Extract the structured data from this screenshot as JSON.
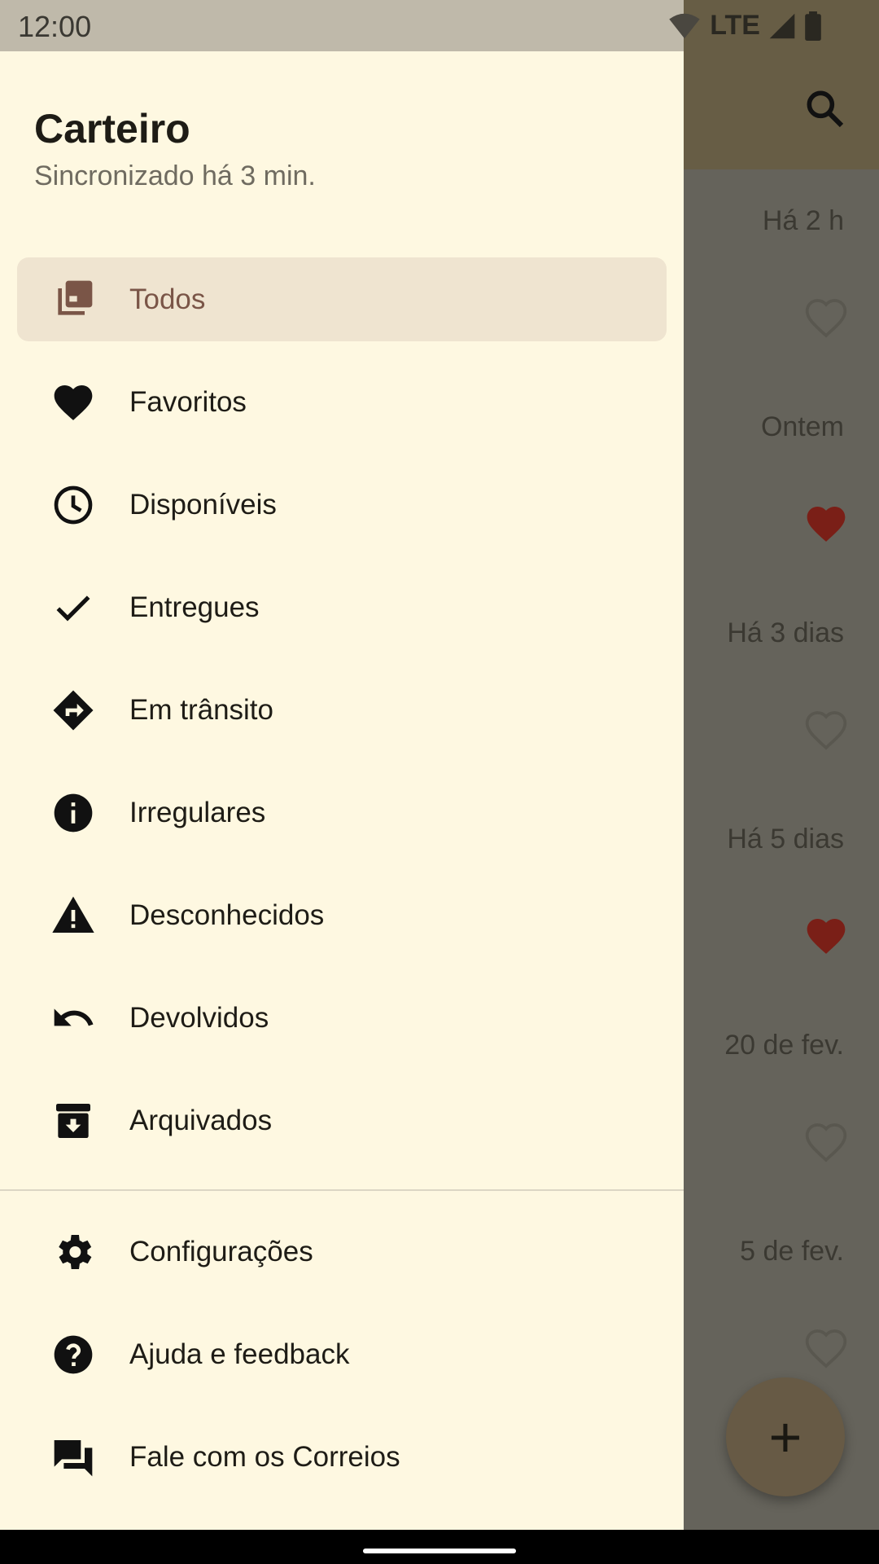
{
  "status_bar": {
    "time": "12:00",
    "network": "LTE"
  },
  "background": {
    "search_icon": "search-icon",
    "rows": [
      {
        "date": "Há 2 h",
        "favorite": false
      },
      {
        "date": "Ontem",
        "favorite": true
      },
      {
        "date": "Há 3 dias",
        "favorite": false
      },
      {
        "date": "Há 5 dias",
        "favorite": true
      },
      {
        "date": "20 de fev.",
        "favorite": false
      },
      {
        "date": "5 de fev.",
        "favorite": false
      }
    ],
    "fab_label": "+",
    "heart_color": "#7a1f17"
  },
  "drawer": {
    "title": "Carteiro",
    "subtitle": "Sincronizado há 3 min.",
    "items": [
      {
        "label": "Todos",
        "icon": "collection-icon",
        "active": true
      },
      {
        "label": "Favoritos",
        "icon": "heart-icon"
      },
      {
        "label": "Disponíveis",
        "icon": "clock-icon"
      },
      {
        "label": "Entregues",
        "icon": "check-icon"
      },
      {
        "label": "Em trânsito",
        "icon": "directions-icon"
      },
      {
        "label": "Irregulares",
        "icon": "info-icon"
      },
      {
        "label": "Desconhecidos",
        "icon": "warning-icon"
      },
      {
        "label": "Devolvidos",
        "icon": "undo-icon"
      },
      {
        "label": "Arquivados",
        "icon": "archive-icon"
      }
    ],
    "footer_items": [
      {
        "label": "Configurações",
        "icon": "gear-icon"
      },
      {
        "label": "Ajuda e feedback",
        "icon": "help-icon"
      },
      {
        "label": "Fale com os Correios",
        "icon": "chat-icon"
      }
    ]
  }
}
